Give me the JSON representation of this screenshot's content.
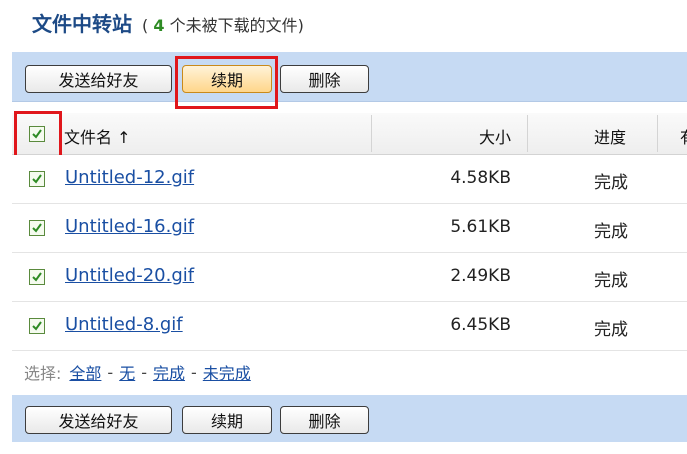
{
  "header": {
    "title": "文件中转站",
    "subtitle_open": "(",
    "count": "4",
    "subtitle_rest": "个未被下载的文件)"
  },
  "toolbar": {
    "send_label": "发送给好友",
    "renew_label": "续期",
    "delete_label": "删除"
  },
  "table": {
    "columns": {
      "name": "文件名",
      "sort_arrow": "↑",
      "size": "大小",
      "progress": "进度",
      "extra": "有"
    },
    "header_checkbox_checked": true,
    "rows": [
      {
        "name": "Untitled-12.gif",
        "size": "4.58KB",
        "progress": "完成",
        "checked": true
      },
      {
        "name": "Untitled-16.gif",
        "size": "5.61KB",
        "progress": "完成",
        "checked": true
      },
      {
        "name": "Untitled-20.gif",
        "size": "2.49KB",
        "progress": "完成",
        "checked": true
      },
      {
        "name": "Untitled-8.gif",
        "size": "6.45KB",
        "progress": "完成",
        "checked": true
      }
    ]
  },
  "selection": {
    "label": "选择:",
    "all": "全部",
    "none": "无",
    "done": "完成",
    "undone": "未完成",
    "dash": "-"
  },
  "colors": {
    "title": "#1d4a86",
    "count": "#2e8b24",
    "toolbar_bg": "#c6daf3",
    "link": "#1a4fa3",
    "highlight": "#e0161b"
  }
}
